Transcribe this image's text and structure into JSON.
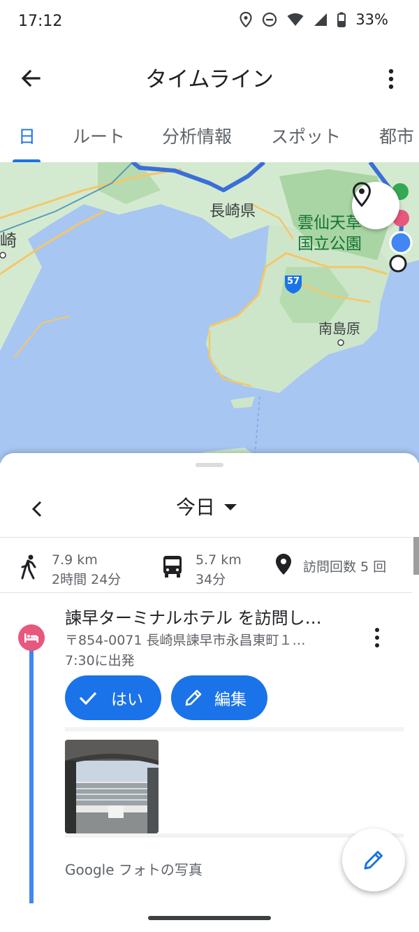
{
  "status": {
    "time": "17:12",
    "battery": "33%"
  },
  "appbar": {
    "title": "タイムライン"
  },
  "tabs": [
    {
      "label": "日"
    },
    {
      "label": "ルート"
    },
    {
      "label": "分析情報"
    },
    {
      "label": "スポット"
    },
    {
      "label": "都市"
    }
  ],
  "map": {
    "labels": {
      "nagasaki_pref": "長崎県",
      "unzen_line1": "雲仙天草",
      "unzen_line2": "国立公園",
      "minamishimabara": "南島原",
      "left_city": "崎",
      "route_57": "57"
    }
  },
  "sheet": {
    "date_label": "今日",
    "stats": {
      "walk_distance": "7.9 km",
      "walk_time": "2時間 24分",
      "transit_distance": "5.7 km",
      "transit_time": "34分",
      "visits": "訪問回数 5 回"
    },
    "visit": {
      "title": "諫早ターミナルホテル を訪問し…",
      "address": "〒854-0071 長崎県諫早市永昌東町１…",
      "departure": "7:30に出発",
      "yes_label": "はい",
      "edit_label": "編集",
      "photo_caption": "Google フォトの写真"
    }
  },
  "colors": {
    "accent": "#1a73e8",
    "hotel": "#e8577e",
    "water": "#a7c6f2",
    "land": "#cfe8cf"
  }
}
